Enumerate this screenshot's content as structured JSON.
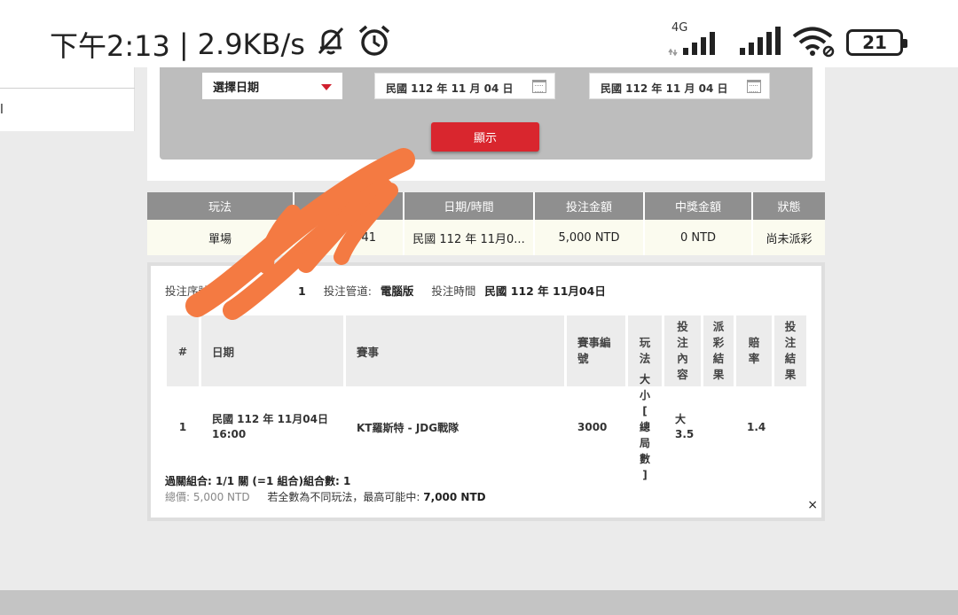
{
  "status_bar": {
    "time": "下午2:13",
    "separator": "|",
    "speed": "2.9KB/s",
    "network": "4G",
    "battery": "21"
  },
  "sidebar": {
    "partial_text": "l"
  },
  "filter": {
    "date_select": "選擇日期",
    "start_date": "民國 112 年 11 月 04 日",
    "end_date": "民國 112 年 11 月 04 日",
    "show_button": "顯示"
  },
  "results": {
    "headers": [
      "玩法",
      "",
      "日期/時間",
      "投注金額",
      "中獎金額",
      "狀態"
    ],
    "row": [
      "單場",
      "41",
      "民國 112 年 11月0...",
      "5,000 NTD",
      "0 NTD",
      "尚未派彩"
    ]
  },
  "detail": {
    "serial_label": "投注序號",
    "serial_value": "1",
    "channel_label": "投注管道:",
    "channel_value": "電腦版",
    "time_label": "投注時間",
    "time_value": "民國 112 年 11月04日",
    "headers": {
      "num": "#",
      "date": "日期",
      "event": "賽事",
      "event_no": "賽事編號",
      "play": "玩法",
      "content": "投注內容",
      "payout": "派彩結果",
      "odds": "賠率",
      "result": "投注結果"
    },
    "row": {
      "num": "1",
      "date": "民國 112 年 11月04日 16:00",
      "event": "KT羅斯特 - JDG戰隊",
      "event_no": "3000",
      "play": "大小[總局數]",
      "content": "大 3.5",
      "payout": "",
      "odds": "1.4",
      "result": ""
    },
    "combo_line": "過關組合: 1/1 關 (=1 組合)組合數: 1",
    "total_label": "總價:",
    "total_value": "5,000 NTD",
    "max_win_label": "若全數為不同玩法，最高可能中:",
    "max_win_value": "7,000 NTD",
    "close": "×"
  },
  "colors": {
    "accent_red": "#d9262e",
    "header_gray": "#8f8f8f",
    "filter_gray": "#bdbdbd",
    "row_cream": "#fbfbef",
    "scribble_orange": "#f47a42"
  }
}
